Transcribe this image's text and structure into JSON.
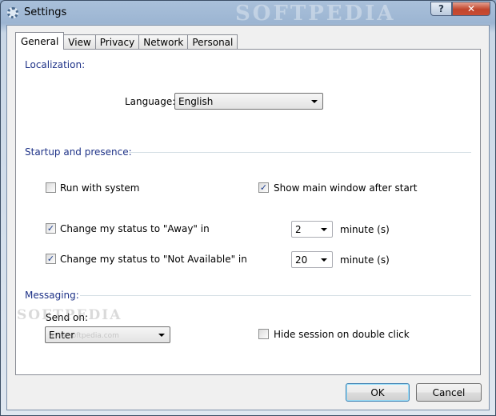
{
  "window": {
    "title": "Settings",
    "help_label": "?",
    "close_label": "✕",
    "watermark": "SOFTPEDIA",
    "icon": "gear-icon"
  },
  "tabs": [
    {
      "label": "General",
      "active": true
    },
    {
      "label": "View",
      "active": false
    },
    {
      "label": "Privacy",
      "active": false
    },
    {
      "label": "Network",
      "active": false
    },
    {
      "label": "Personal",
      "active": false
    }
  ],
  "localization": {
    "title": "Localization:",
    "language_label": "Language:",
    "language_value": "English"
  },
  "startup": {
    "title": "Startup and presence:",
    "run_with_system": {
      "label": "Run with system",
      "checked": false
    },
    "show_main_window": {
      "label": "Show main window after start",
      "checked": true
    },
    "away": {
      "label": "Change my status to \"Away\" in",
      "checked": true,
      "value": "2",
      "unit": "minute (s)"
    },
    "not_available": {
      "label": "Change my status to \"Not Available\" in",
      "checked": true,
      "value": "20",
      "unit": "minute (s)"
    }
  },
  "messaging": {
    "title": "Messaging:",
    "send_on_label": "Send on:",
    "send_on_value": "Enter",
    "hide_session": {
      "label": "Hide session on double click",
      "checked": false
    }
  },
  "buttons": {
    "ok": "OK",
    "cancel": "Cancel"
  },
  "softpedia_overlay": {
    "text": "SOFTPEDIA",
    "url": "www.softpedia.com"
  },
  "checkmark": "✓"
}
